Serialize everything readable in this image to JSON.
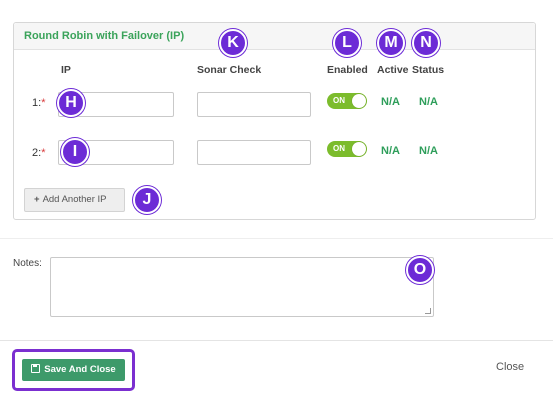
{
  "panel": {
    "title": "Round Robin with Failover (IP)"
  },
  "columns": {
    "ip": "IP",
    "sonar_check": "Sonar Check",
    "enabled": "Enabled",
    "active": "Active",
    "status": "Status"
  },
  "rows": [
    {
      "label": "1:",
      "required": "*",
      "ip_value": "",
      "sonar_value": "",
      "toggle": "ON",
      "active": "N/A",
      "status": "N/A"
    },
    {
      "label": "2:",
      "required": "*",
      "ip_value": "",
      "sonar_value": "",
      "toggle": "ON",
      "active": "N/A",
      "status": "N/A"
    }
  ],
  "add_button": {
    "label": "Add Another IP",
    "icon": "plus-icon"
  },
  "notes": {
    "label": "Notes:",
    "value": ""
  },
  "footer": {
    "save_label": "Save And Close",
    "save_icon": "floppy-disk-icon",
    "close_label": "Close"
  },
  "badges": {
    "h": "H",
    "i": "I",
    "j": "J",
    "k": "K",
    "l": "L",
    "m": "M",
    "n": "N",
    "o": "O"
  },
  "colors": {
    "accent_green": "#3aa35a",
    "toggle_green": "#7cbc2c",
    "save_green": "#3d9a6a",
    "badge_purple": "#6c2bd6",
    "required_red": "#d9393a"
  }
}
